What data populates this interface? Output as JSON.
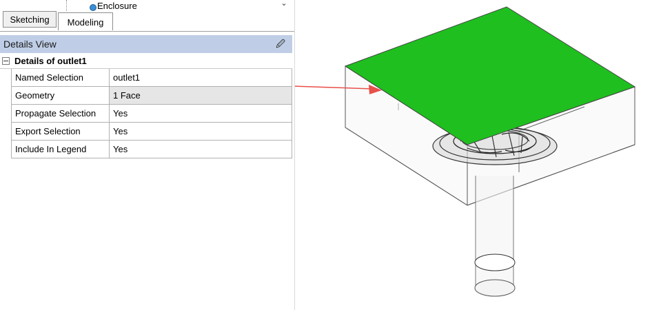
{
  "tree": {
    "visible_node_label": "Enclosure",
    "node_icon": "body-icon"
  },
  "tabs": [
    {
      "label": "Sketching",
      "active": false
    },
    {
      "label": "Modeling",
      "active": true
    }
  ],
  "details_view": {
    "title": "Details View",
    "pin_icon": "pin-icon",
    "group_label": "Details of outlet1",
    "rows": [
      {
        "name": "Named Selection",
        "value": "outlet1"
      },
      {
        "name": "Geometry",
        "value": "1 Face"
      },
      {
        "name": "Propagate Selection",
        "value": "Yes"
      },
      {
        "name": "Export Selection",
        "value": "Yes"
      },
      {
        "name": "Include In Legend",
        "value": "Yes"
      }
    ]
  },
  "colors": {
    "header_bg": "#bfcee6",
    "selected_face": "#1fbf1f",
    "arrow": "#e8504a"
  }
}
